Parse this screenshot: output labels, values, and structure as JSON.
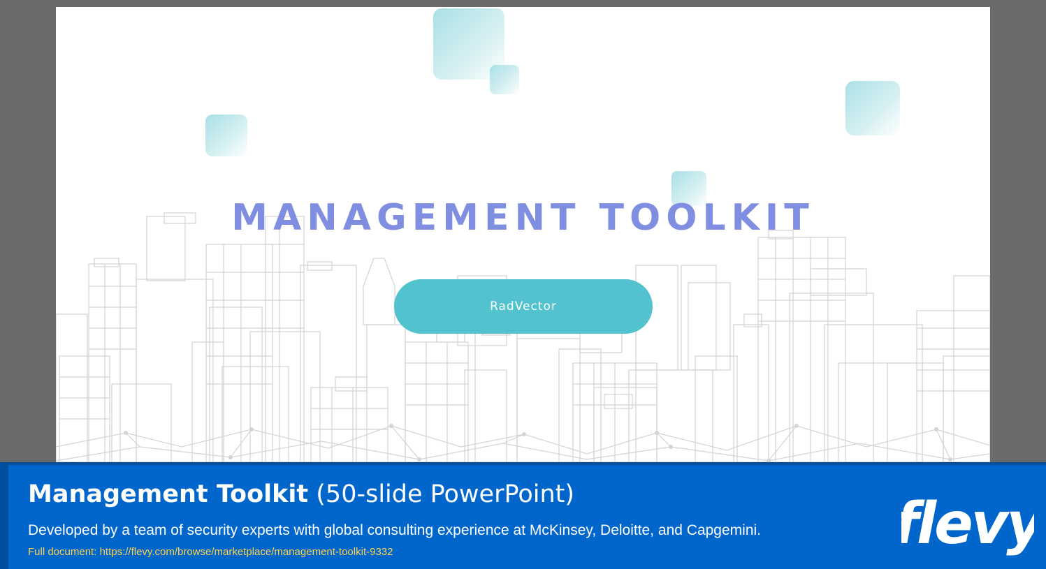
{
  "slide": {
    "title": "MANAGEMENT TOOLKIT",
    "button_label": "RadVector"
  },
  "footer": {
    "title_bold": "Management Toolkit",
    "title_sub": "(50-slide PowerPoint)",
    "description": "Developed by a team of security experts with global consulting experience at McKinsey, Deloitte, and Capgemini.",
    "link_label": "Full document:",
    "link_url": "https://flevy.com/browse/marketplace/management-toolkit-9332",
    "logo": "flevy"
  },
  "colors": {
    "title": "#7f8ee0",
    "pill": "#4ac0cc",
    "footer": "#0066cc",
    "link": "#ffd24a"
  }
}
